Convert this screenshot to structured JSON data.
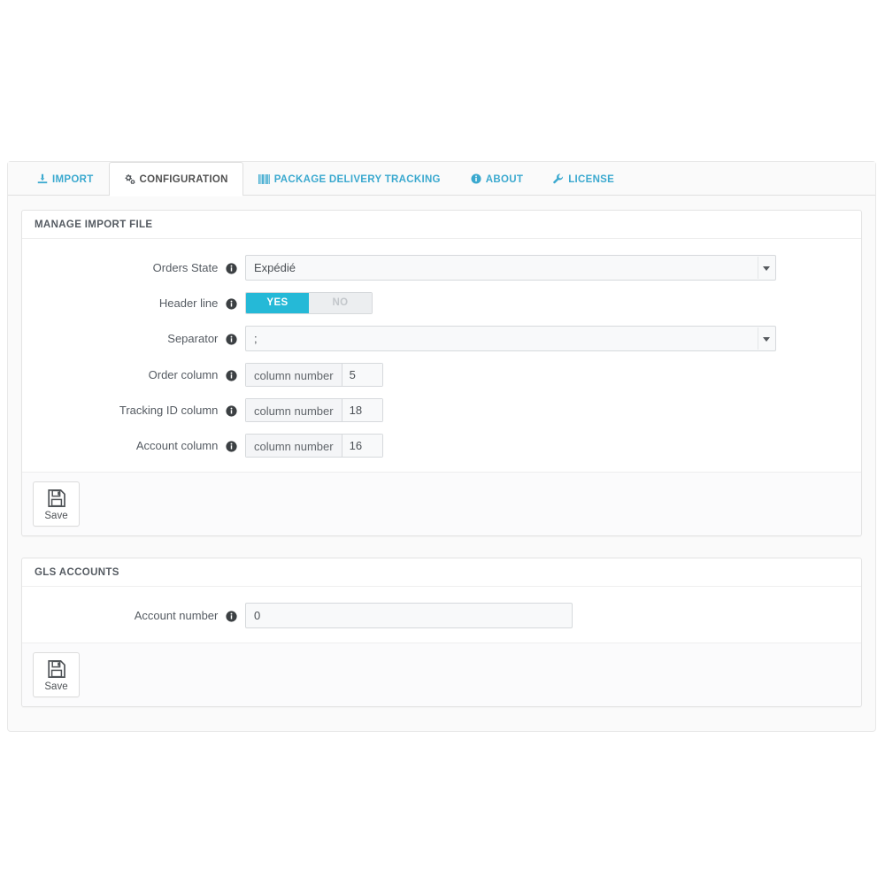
{
  "tabs": [
    {
      "id": "import",
      "label": "IMPORT",
      "icon": "download-icon",
      "active": false
    },
    {
      "id": "config",
      "label": "CONFIGURATION",
      "icon": "gears-icon",
      "active": true
    },
    {
      "id": "tracking",
      "label": "PACKAGE DELIVERY TRACKING",
      "icon": "barcode-icon",
      "active": false
    },
    {
      "id": "about",
      "label": "ABOUT",
      "icon": "info-circle-icon",
      "active": false
    },
    {
      "id": "license",
      "label": "LICENSE",
      "icon": "wrench-icon",
      "active": false
    }
  ],
  "panels": {
    "import_file": {
      "heading": "MANAGE IMPORT FILE",
      "rows": {
        "orders_state": {
          "label": "Orders State",
          "value": "Expédié",
          "info_icon": "info-icon"
        },
        "header_line": {
          "label": "Header line",
          "on_label": "YES",
          "off_label": "NO",
          "value": "YES",
          "info_icon": "info-icon"
        },
        "separator": {
          "label": "Separator",
          "value": ";",
          "info_icon": "info-icon"
        },
        "order_column": {
          "label": "Order column",
          "addon": "column number",
          "value": "5",
          "info_icon": "info-icon"
        },
        "tracking_id_column": {
          "label": "Tracking ID column",
          "addon": "column number",
          "value": "18",
          "info_icon": "info-icon"
        },
        "account_column": {
          "label": "Account column",
          "addon": "column number",
          "value": "16",
          "info_icon": "info-icon"
        }
      },
      "save": {
        "label": "Save",
        "icon": "floppy-disk-icon"
      }
    },
    "gls_accounts": {
      "heading": "GLS ACCOUNTS",
      "rows": {
        "account_number": {
          "label": "Account number",
          "value": "0",
          "info_icon": "info-icon"
        }
      },
      "save": {
        "label": "Save",
        "icon": "floppy-disk-icon"
      }
    }
  },
  "colors": {
    "tab_link": "#3ba9cf",
    "switch_on": "#25b9d7",
    "switch_off_bg": "#eceef0",
    "panel_border": "#e3e3e3",
    "heading_text": "#555b62"
  }
}
